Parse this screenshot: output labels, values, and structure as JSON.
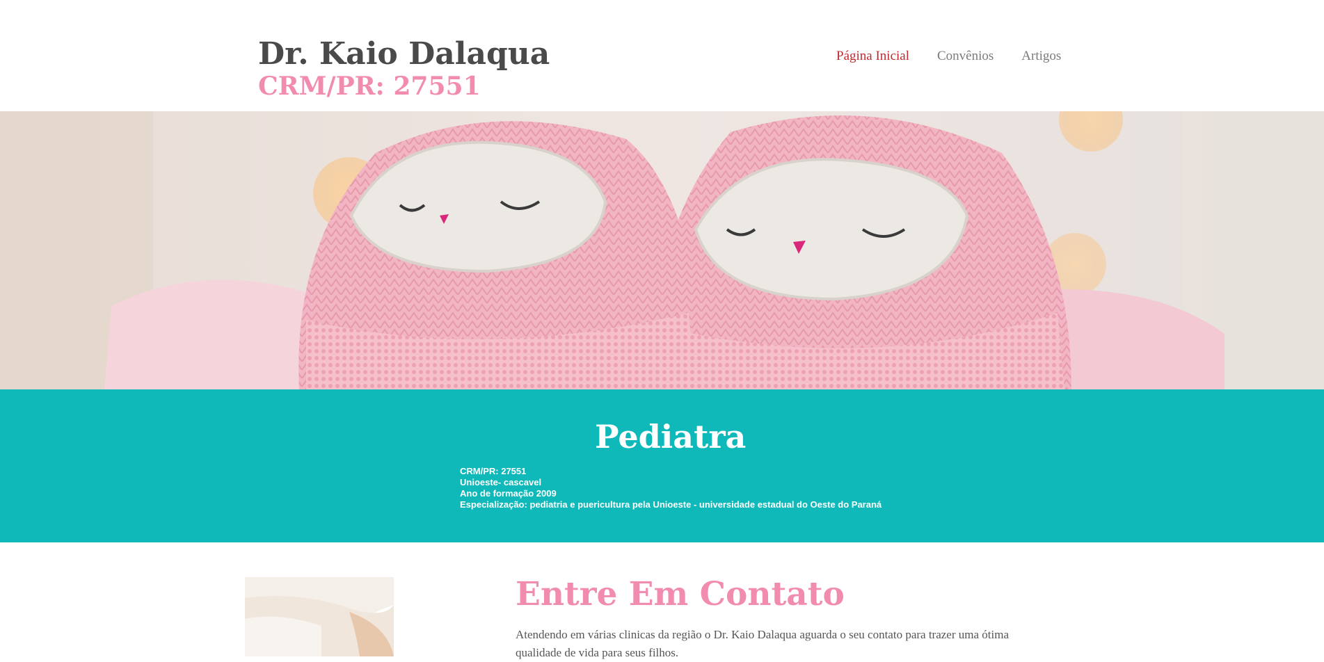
{
  "header": {
    "title": "Dr. Kaio Dalaqua",
    "crm": "CRM/PR: 27551"
  },
  "nav": {
    "items": [
      {
        "label": "Página Inicial",
        "active": true
      },
      {
        "label": "Convênios",
        "active": false
      },
      {
        "label": "Artigos",
        "active": false
      }
    ]
  },
  "band": {
    "title": "Pediatra",
    "details": [
      "CRM/PR: 27551",
      "Unioeste- cascavel",
      "Ano de formação 2009",
      "Especialização: pediatria e puericultura pela Unioeste - universidade estadual do Oeste do Paraná"
    ]
  },
  "contact": {
    "title": "Entre Em Contato",
    "text": "Atendendo em várias clinicas da região o Dr. Kaio Dalaqua aguarda o seu contato para trazer uma ótima qualidade de vida para seus filhos."
  },
  "colors": {
    "accent_pink": "#f18cb0",
    "teal_band": "#0fb8b9",
    "nav_active": "#c0282d",
    "text_dark": "#4a4a4a"
  }
}
